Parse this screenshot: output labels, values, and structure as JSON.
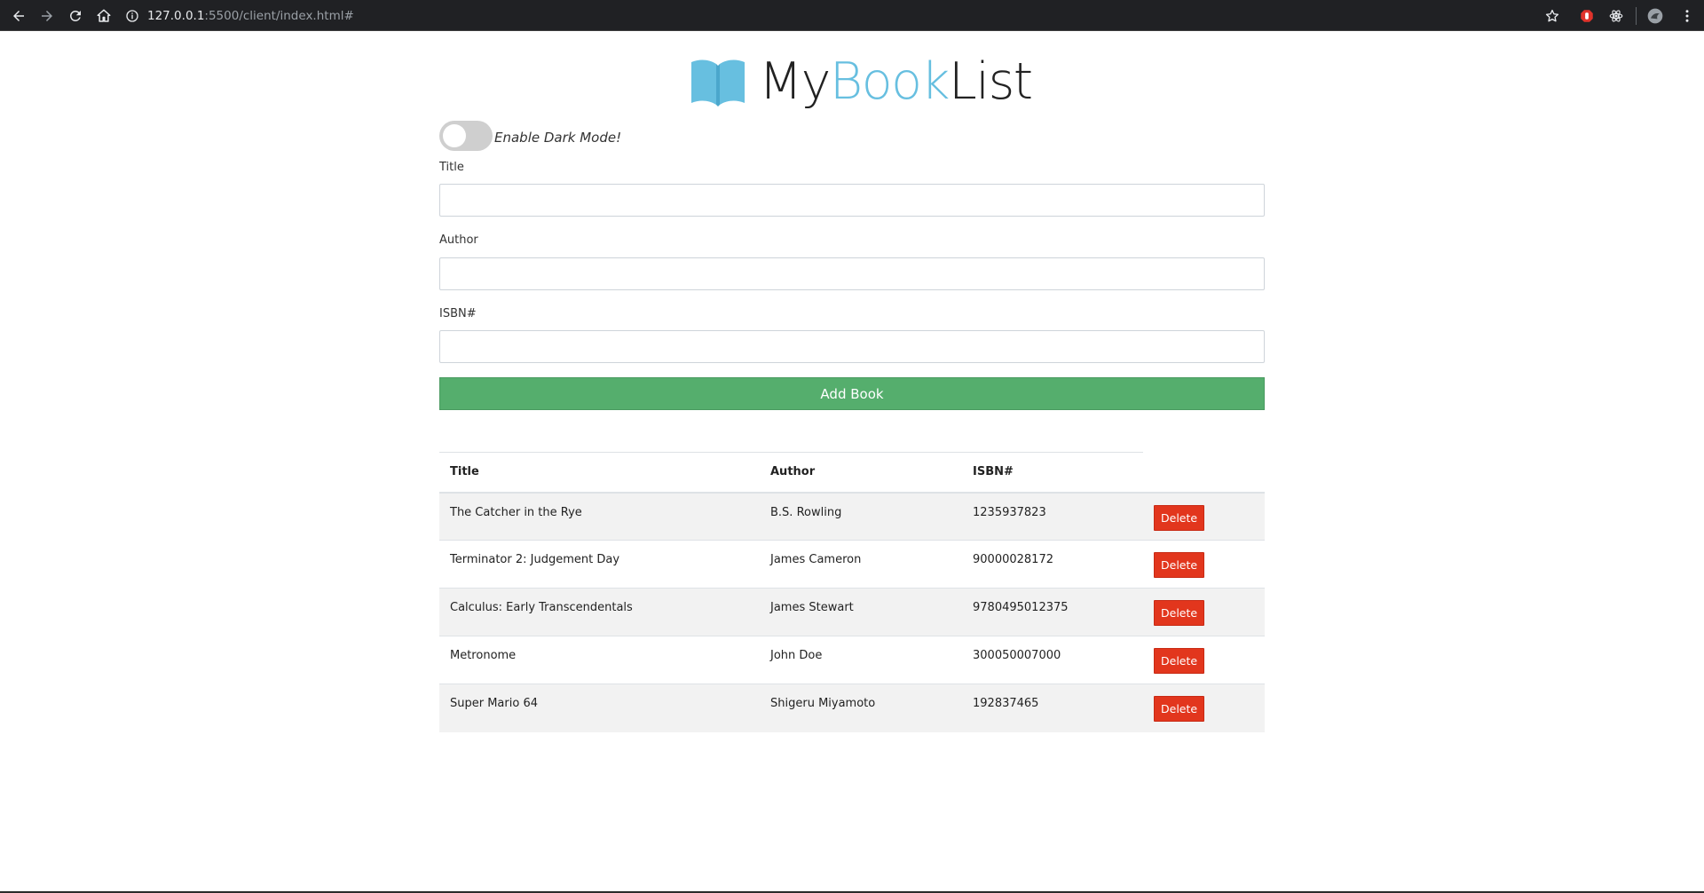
{
  "browser": {
    "url_host": "127.0.0.1",
    "url_rest": ":5500/client/index.html#"
  },
  "brand": {
    "part1": "My",
    "part2": "Book",
    "part3": "List",
    "accent_color": "#67bfe0",
    "logo_icon": "open-book-icon"
  },
  "dark_mode": {
    "label": "Enable Dark Mode!",
    "enabled": false
  },
  "form": {
    "title_label": "Title",
    "title_value": "",
    "author_label": "Author",
    "author_value": "",
    "isbn_label": "ISBN#",
    "isbn_value": "",
    "add_button_label": "Add Book",
    "add_button_color": "#55ae6d"
  },
  "table": {
    "headers": [
      "Title",
      "Author",
      "ISBN#"
    ],
    "delete_label": "Delete",
    "delete_color": "#e2361d",
    "rows": [
      {
        "title": "The Catcher in the Rye",
        "author": "B.S. Rowling",
        "isbn": "1235937823"
      },
      {
        "title": "Terminator 2: Judgement Day",
        "author": "James Cameron",
        "isbn": "90000028172"
      },
      {
        "title": "Calculus: Early Transcendentals",
        "author": "James Stewart",
        "isbn": "9780495012375"
      },
      {
        "title": "Metronome",
        "author": "John Doe",
        "isbn": "300050007000"
      },
      {
        "title": "Super Mario 64",
        "author": "Shigeru Miyamoto",
        "isbn": "192837465"
      }
    ]
  }
}
